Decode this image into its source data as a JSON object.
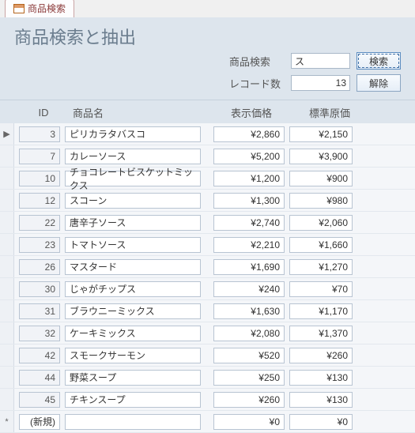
{
  "tab": {
    "label": "商品検索"
  },
  "header": {
    "title": "商品検索と抽出",
    "search_label": "商品検索",
    "search_value": "ス",
    "count_label": "レコード数",
    "count_value": "13",
    "search_btn": "検索",
    "clear_btn": "解除"
  },
  "columns": {
    "id": "ID",
    "name": "商品名",
    "disp_price": "表示価格",
    "std_cost": "標準原価"
  },
  "rows": [
    {
      "id": "3",
      "name": "ピリカラタバスコ",
      "disp": "¥2,860",
      "cost": "¥2,150"
    },
    {
      "id": "7",
      "name": "カレーソース",
      "disp": "¥5,200",
      "cost": "¥3,900"
    },
    {
      "id": "10",
      "name": "チョコレートビスケットミックス",
      "disp": "¥1,200",
      "cost": "¥900"
    },
    {
      "id": "12",
      "name": "スコーン",
      "disp": "¥1,300",
      "cost": "¥980"
    },
    {
      "id": "22",
      "name": "唐辛子ソース",
      "disp": "¥2,740",
      "cost": "¥2,060"
    },
    {
      "id": "23",
      "name": "トマトソース",
      "disp": "¥2,210",
      "cost": "¥1,660"
    },
    {
      "id": "26",
      "name": "マスタード",
      "disp": "¥1,690",
      "cost": "¥1,270"
    },
    {
      "id": "30",
      "name": "じゃがチップス",
      "disp": "¥240",
      "cost": "¥70"
    },
    {
      "id": "31",
      "name": "ブラウニーミックス",
      "disp": "¥1,630",
      "cost": "¥1,170"
    },
    {
      "id": "32",
      "name": "ケーキミックス",
      "disp": "¥2,080",
      "cost": "¥1,370"
    },
    {
      "id": "42",
      "name": "スモークサーモン",
      "disp": "¥520",
      "cost": "¥260"
    },
    {
      "id": "44",
      "name": "野菜スープ",
      "disp": "¥250",
      "cost": "¥130"
    },
    {
      "id": "45",
      "name": "チキンスープ",
      "disp": "¥260",
      "cost": "¥130"
    }
  ],
  "new_row": {
    "id": "(新規)",
    "name": "",
    "disp": "¥0",
    "cost": "¥0"
  },
  "selectors": {
    "current": "▶",
    "new": "*"
  }
}
